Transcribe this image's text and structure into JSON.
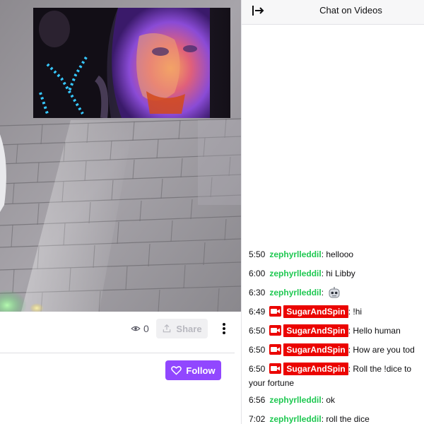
{
  "video": {
    "views_count": "0",
    "share_label": "Share",
    "follow_label": "Follow"
  },
  "chat": {
    "title": "Chat on Videos",
    "messages": [
      {
        "time": "5:50",
        "user": "zephyrlleddil",
        "text": ": hellooo"
      },
      {
        "time": "6:00",
        "user": "zephyrlleddil",
        "text": ": hi Libby"
      },
      {
        "time": "6:30",
        "user": "zephyrlleddil",
        "text": ":"
      },
      {
        "time": "6:49",
        "user": "SugarAndSpin",
        "text": ": !hi"
      },
      {
        "time": "6:50",
        "user": "SugarAndSpin",
        "text": ": Hello human"
      },
      {
        "time": "6:50",
        "user": "SugarAndSpin",
        "text": ": How are you tod"
      },
      {
        "time": "6:50",
        "user": "SugarAndSpin",
        "text": ": Roll the !dice to",
        "text2": "your fortune"
      },
      {
        "time": "6:56",
        "user": "zephyrlleddil",
        "text": ": ok"
      },
      {
        "time": "7:02",
        "user": "zephyrlleddil",
        "text": ": roll the dice"
      }
    ]
  },
  "colors": {
    "accent": "#9147ff",
    "chat_user_green": "#1ec851",
    "highlight_red": "#eb0400"
  },
  "icons": {
    "collapse": "collapse-arrow-icon",
    "views": "eye-icon",
    "share": "share-upload-icon",
    "more": "vertical-dots-icon",
    "follow": "heart-icon",
    "badge": "video-camera-icon",
    "emote": "robot-emote-icon"
  }
}
